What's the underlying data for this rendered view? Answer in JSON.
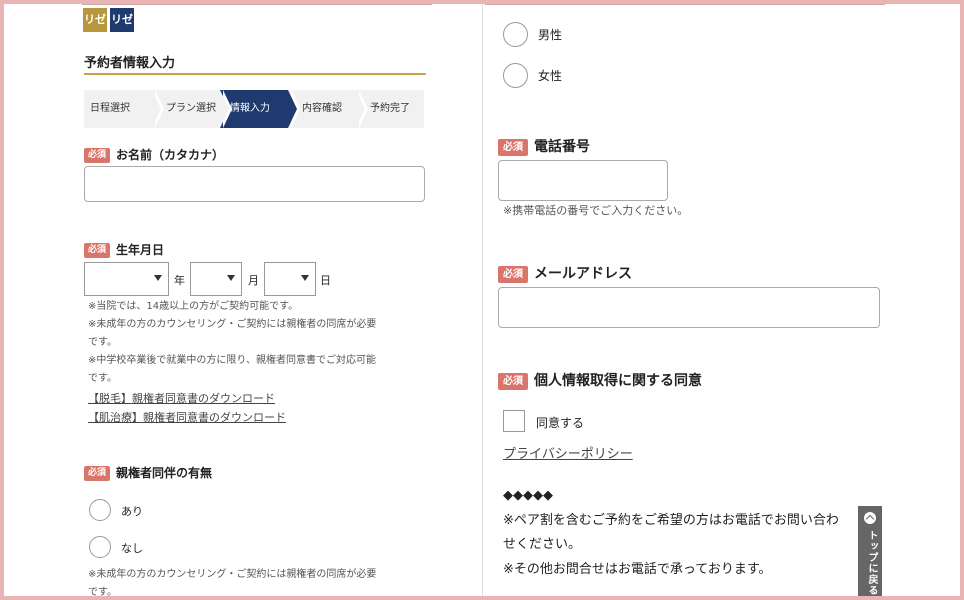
{
  "logo": {
    "mark1": "リゼ",
    "mark2": "リゼ"
  },
  "form": {
    "title": "予約者情報入力",
    "required_label": "必須",
    "steps": [
      {
        "label": "日程選択",
        "active": false
      },
      {
        "label": "プラン選択",
        "active": false
      },
      {
        "label": "情報入力",
        "active": true
      },
      {
        "label": "内容確認",
        "active": false
      },
      {
        "label": "予約完了",
        "active": false
      }
    ],
    "name_label": "お名前（カタカナ）",
    "birth_label": "生年月日",
    "birth_units": {
      "year": "年",
      "month": "月",
      "day": "日"
    },
    "birth_notes": [
      "※当院では、14歳以上の方がご契約可能です。",
      "※未成年の方のカウンセリング・ご契約には親権者の同席が必要",
      "です。",
      "※中学校卒業後で就業中の方に限り、親権者同意書でご対応可能",
      "です。"
    ],
    "download_links": [
      "【脱毛】親権者同意書のダウンロード",
      "【肌治療】親権者同意書のダウンロード"
    ],
    "guardian_label": "親権者同伴の有無",
    "guardian_options": [
      "あり",
      "なし"
    ],
    "guardian_notes": [
      "※未成年の方のカウンセリング・ご契約には親権者の同席が必要",
      "です。"
    ],
    "gender_options": [
      "男性",
      "女性"
    ],
    "phone_label": "電話番号",
    "phone_note": "※携帯電話の番号でご入力ください。",
    "email_label": "メールアドレス",
    "consent_label": "個人情報取得に関する同意",
    "consent_check": "同意する",
    "privacy_link": "プライバシーポリシー",
    "info_lines": [
      "◆◆◆◆◆",
      "※ペア割を含むご予約をご希望の方はお電話でお問い合わ",
      "せください。",
      "※その他お問合せはお電話で承っております。"
    ]
  },
  "to_top": {
    "label": "トップに戻る"
  },
  "colors": {
    "accent_navy": "#1f3a6f",
    "gold": "#c9a24a",
    "required": "#d9756b",
    "frame": "#e8b4b4"
  }
}
